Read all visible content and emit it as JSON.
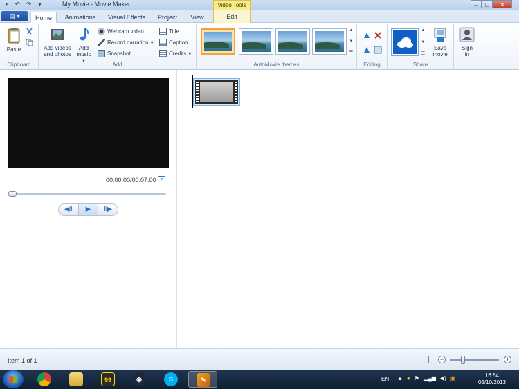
{
  "window": {
    "title": "My Movie - Movie Maker",
    "context_group": "Video Tools"
  },
  "tabs": [
    {
      "label": "Home"
    },
    {
      "label": "Animations"
    },
    {
      "label": "Visual Effects"
    },
    {
      "label": "Project"
    },
    {
      "label": "View"
    },
    {
      "label": "Edit"
    }
  ],
  "ribbon": {
    "clipboard": {
      "label": "Clipboard",
      "paste": "Paste"
    },
    "add": {
      "label": "Add",
      "add_videos_line1": "Add videos",
      "add_videos_line2": "and photos",
      "add_music_line1": "Add",
      "add_music_line2": "music",
      "webcam": "Webcam video",
      "narration": "Record narration",
      "snapshot": "Snapshot",
      "title": "Title",
      "caption": "Caption",
      "credits": "Credits"
    },
    "themes": {
      "label": "AutoMovie themes"
    },
    "editing": {
      "label": "Editing"
    },
    "share": {
      "label": "Share",
      "save_line1": "Save",
      "save_line2": "movie"
    },
    "signin": {
      "line1": "Sign",
      "line2": "in"
    }
  },
  "preview": {
    "timecode": "00:00.00/00:07.00",
    "progress": 0
  },
  "status": {
    "text": "Item 1 of 1"
  },
  "taskbar": {
    "language": "EN",
    "time": "16:54",
    "date": "05/10/2013"
  },
  "colors": {
    "accent": "#1d4d9e",
    "selected_theme": "#f1a33c",
    "context_tab": "#f8ec8a",
    "onedrive": "#0f5fc5"
  }
}
